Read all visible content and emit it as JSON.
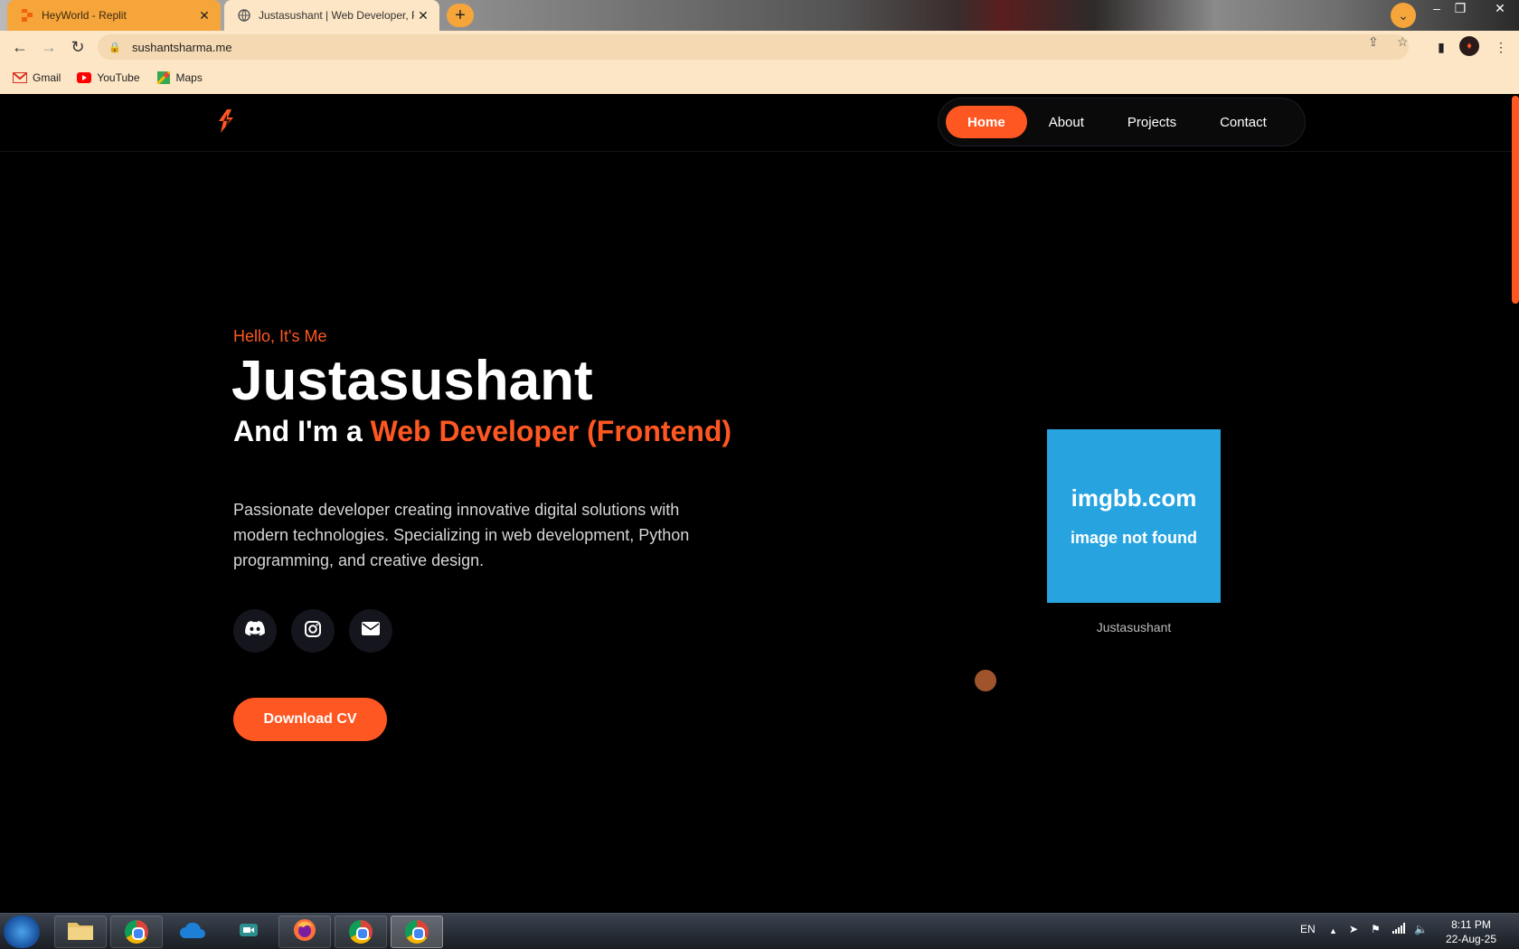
{
  "browser": {
    "tabs": [
      {
        "title": "HeyWorld - Replit",
        "active": false
      },
      {
        "title": "Justasushant | Web Developer, Py",
        "active": true
      }
    ],
    "url": "sushantsharma.me",
    "bookmarks": [
      {
        "label": "Gmail",
        "icon": "gmail-icon"
      },
      {
        "label": "YouTube",
        "icon": "youtube-icon"
      },
      {
        "label": "Maps",
        "icon": "maps-icon"
      }
    ],
    "accent": "#f6a53a"
  },
  "site": {
    "nav": {
      "items": [
        {
          "label": "Home",
          "active": true
        },
        {
          "label": "About",
          "active": false
        },
        {
          "label": "Projects",
          "active": false
        },
        {
          "label": "Contact",
          "active": false
        }
      ]
    },
    "hero": {
      "greeting": "Hello, It's Me",
      "name": "Justasushant",
      "role_prefix": "And I'm a",
      "role": "Web Developer (Frontend)",
      "description": "Passionate developer creating innovative digital solutions with modern technologies. Specializing in web development, Python programming, and creative design.",
      "socials": [
        {
          "icon": "discord-icon"
        },
        {
          "icon": "instagram-icon"
        },
        {
          "icon": "mail-icon"
        }
      ],
      "cta": "Download CV"
    },
    "profile": {
      "image_line1": "imgbb.com",
      "image_line2": "image not found",
      "caption": "Justasushant"
    },
    "colors": {
      "accent": "#ff5722",
      "background": "#000000",
      "image_placeholder": "#27a4e0"
    }
  },
  "taskbar": {
    "language": "EN",
    "time": "8:11 PM",
    "date": "22-Aug-25"
  }
}
